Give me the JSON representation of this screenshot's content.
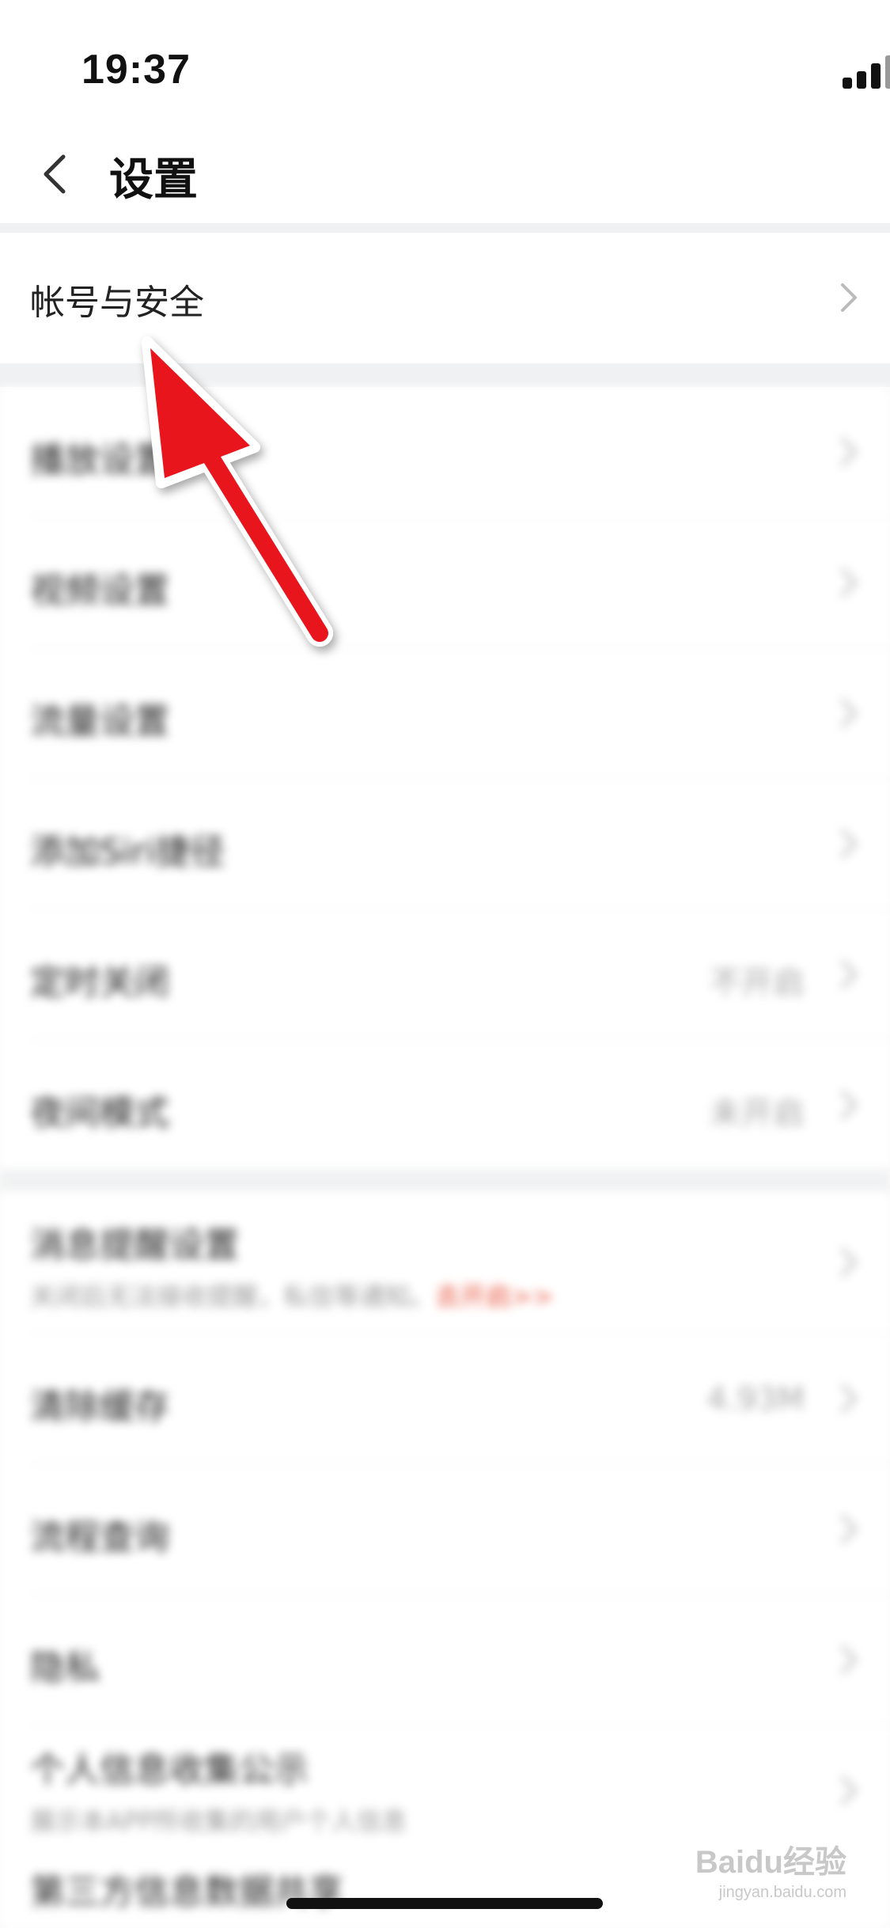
{
  "status_bar": {
    "time": "19:37",
    "icons": [
      "signal-icon",
      "wifi-icon",
      "battery-icon"
    ]
  },
  "header": {
    "back_icon": "chevron-left-icon",
    "title": "设置"
  },
  "featured_item": {
    "label": "帐号与安全",
    "icon": "chevron-right-icon"
  },
  "settings_group_1": [
    {
      "label": "播放设置",
      "value": ""
    },
    {
      "label": "视频设置",
      "value": ""
    },
    {
      "label": "流量设置",
      "value": ""
    },
    {
      "label": "添加Siri捷径",
      "value": ""
    },
    {
      "label": "定时关闭",
      "value": "不开启"
    },
    {
      "label": "夜间模式",
      "value": "未开启"
    }
  ],
  "settings_group_2": [
    {
      "label": "消息提醒设置",
      "sub": "关闭后无法接收提醒，私信等通知。",
      "sub_link": "去开启>>",
      "value": ""
    },
    {
      "label": "清除缓存",
      "value": "4.93M"
    },
    {
      "label": "流程查询",
      "value": ""
    },
    {
      "label": "隐私",
      "value": ""
    },
    {
      "label": "个人信息收集公示",
      "sub": "展示本APP所收集的用户个人信息",
      "value": ""
    },
    {
      "label": "第三方信息数据共享",
      "value": ""
    }
  ],
  "annotation": {
    "type": "arrow",
    "color": "#e8131b"
  },
  "watermark": {
    "brand": "Baidu经验",
    "url": "jingyan.baidu.com"
  },
  "colors": {
    "background": "#ffffff",
    "section_gap": "#f0f1f2",
    "accent_link": "#e8523a",
    "arrow": "#e8131b"
  }
}
